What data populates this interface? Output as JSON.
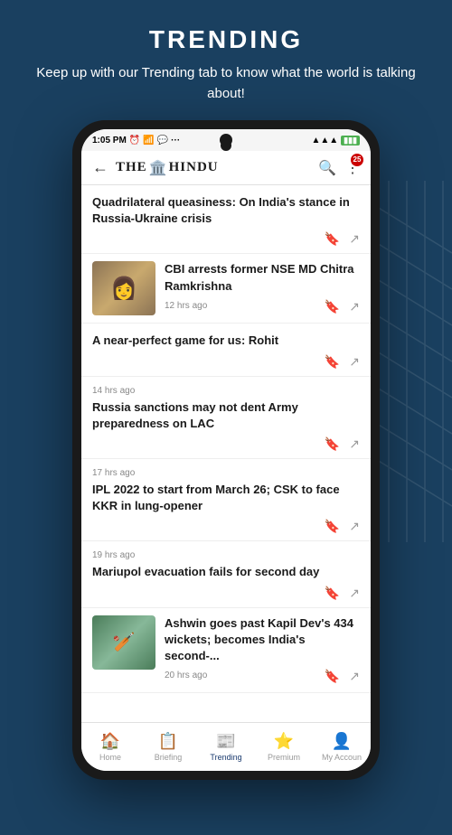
{
  "header": {
    "title": "TRENDING",
    "subtitle": "Keep up with our Trending tab to know what the world is talking about!"
  },
  "status_bar": {
    "time": "1:05 PM",
    "signal": "▲▲▲",
    "battery": "■"
  },
  "app_header": {
    "logo_the": "THE",
    "logo_hindu": "HINDU",
    "badge_count": "25",
    "back_label": "←",
    "search_label": "🔍",
    "menu_label": "⋮"
  },
  "news_items": [
    {
      "id": 1,
      "time": "",
      "title": "Quadrilateral queasiness: On India's stance in Russia-Ukraine crisis",
      "has_image": false,
      "hours_ago": "12 hrs ago"
    },
    {
      "id": 2,
      "time": "12 hrs ago",
      "title": "CBI arrests former NSE MD Chitra Ramkrishna",
      "has_image": true,
      "image_type": "person",
      "hours_ago": "12 hrs ago"
    },
    {
      "id": 3,
      "time": "",
      "title": "A near-perfect game for us: Rohit",
      "has_image": false,
      "hours_ago": "14 hrs ago"
    },
    {
      "id": 4,
      "time": "14 hrs ago",
      "title": "Russia sanctions may not dent Army preparedness on LAC",
      "has_image": false,
      "hours_ago": "17 hrs ago"
    },
    {
      "id": 5,
      "time": "17 hrs ago",
      "title": "IPL 2022 to start from March 26; CSK to face KKR in lung-opener",
      "has_image": false,
      "hours_ago": "19 hrs ago"
    },
    {
      "id": 6,
      "time": "19 hrs ago",
      "title": "Mariupol evacuation fails for second day",
      "has_image": false,
      "hours_ago": "20 hrs ago"
    },
    {
      "id": 7,
      "time": "20 hrs ago",
      "title": "Ashwin goes past Kapil Dev's 434 wickets; becomes India's second-...",
      "has_image": true,
      "image_type": "cricket",
      "hours_ago": "20 hrs ago"
    }
  ],
  "bottom_nav": [
    {
      "id": "home",
      "label": "Home",
      "icon": "🏠",
      "active": false
    },
    {
      "id": "briefing",
      "label": "Briefing",
      "icon": "📋",
      "active": false
    },
    {
      "id": "trending",
      "label": "Trending",
      "icon": "📰",
      "active": true
    },
    {
      "id": "premium",
      "label": "Premium",
      "icon": "⭐",
      "active": false
    },
    {
      "id": "myaccount",
      "label": "My Accoun",
      "icon": "👤",
      "active": false
    }
  ]
}
